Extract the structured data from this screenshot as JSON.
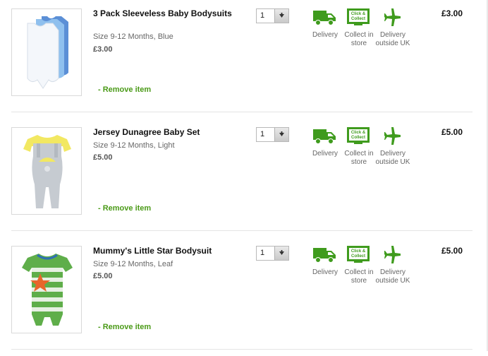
{
  "basket": {
    "items": [
      {
        "title": "3 Pack Sleeveless Baby Bodysuits",
        "size": "Size 9-12 Months, Blue",
        "unit_price": "£3.00",
        "remove": "- Remove item",
        "quantity": "1",
        "line_price": "£3.00",
        "image": "baby-bodysuits-image"
      },
      {
        "title": "Jersey Dunagree Baby Set",
        "size": "Size 9-12 Months, Light",
        "unit_price": "£5.00",
        "remove": "- Remove item",
        "quantity": "1",
        "line_price": "£5.00",
        "image": "dungaree-set-image"
      },
      {
        "title": "Mummy's Little Star Bodysuit",
        "size": "Size 9-12 Months, Leaf",
        "unit_price": "£5.00",
        "remove": "- Remove item",
        "quantity": "1",
        "line_price": "£5.00",
        "image": "star-bodysuit-image"
      }
    ],
    "options": {
      "delivery": "Delivery",
      "collect_line1": "Collect in",
      "collect_line2": "store",
      "abroad_line1": "Delivery",
      "abroad_line2": "outside UK",
      "collect_icon_text1": "Click &",
      "collect_icon_text2": "Collect"
    },
    "colors": {
      "accent_green": "#4a9a17",
      "icon_green": "#3f9b1d"
    },
    "icons": {
      "delivery": "truck-icon",
      "collect": "click-collect-icon",
      "abroad": "airplane-icon",
      "quantity": "chevron-down-icon"
    }
  }
}
